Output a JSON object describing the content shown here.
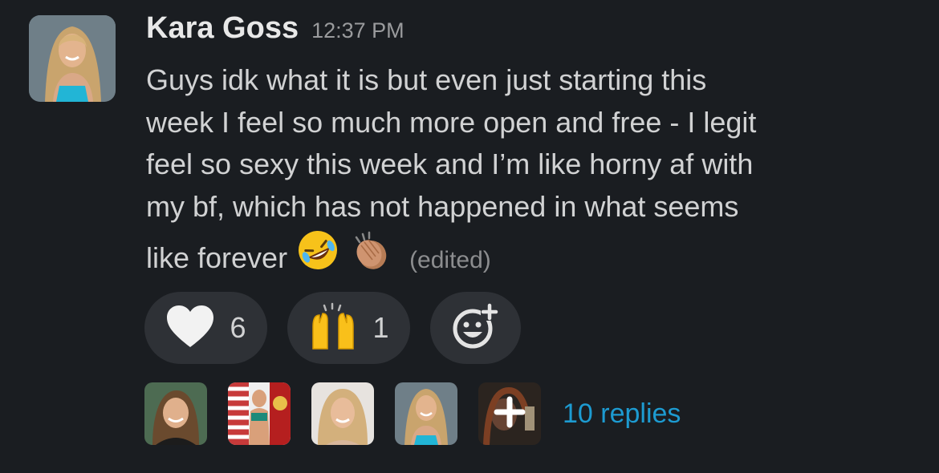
{
  "message": {
    "author": "Kara Goss",
    "timestamp": "12:37 PM",
    "lines": [
      "Guys idk what it is but even just starting this",
      "week I feel so much more open and free - I legit",
      "feel so sexy this week and I’m like horny af with",
      "my bf, which has not happened in what seems",
      "like forever"
    ],
    "emojis": [
      "rolling-on-floor-laughing-emoji",
      "clapping-hands-emoji"
    ],
    "edited_label": "(edited)"
  },
  "reactions": [
    {
      "icon": "white-heart-icon",
      "count": "6"
    },
    {
      "icon": "raising-hands-emoji",
      "count": "1"
    },
    {
      "icon": "add-reaction-icon"
    }
  ],
  "thread": {
    "replies_label": "10 replies",
    "participant_avatar_count": 5
  },
  "colors": {
    "background": "#1a1d21",
    "reaction_pill": "#2e3136",
    "link": "#1d9bd1",
    "text": "#d1d2d3"
  }
}
